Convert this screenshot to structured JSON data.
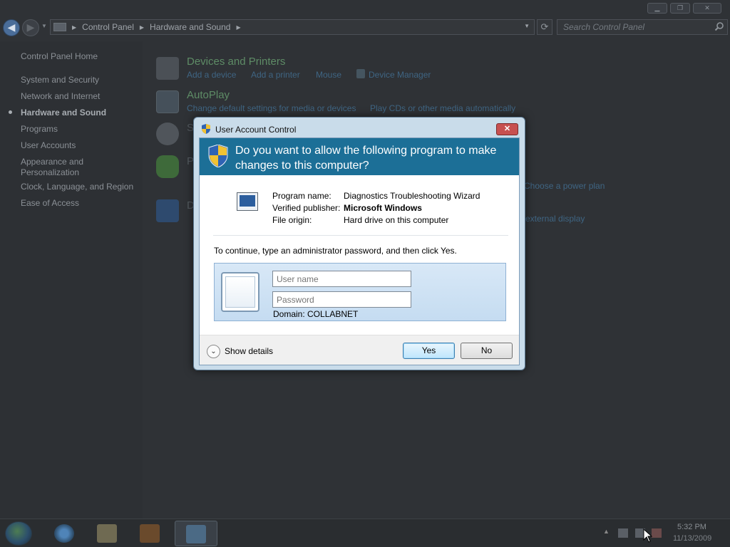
{
  "window": {
    "caption_buttons": [
      "minimize",
      "restore",
      "close"
    ]
  },
  "navbar": {
    "breadcrumb": [
      "Control Panel",
      "Hardware and Sound"
    ],
    "search_placeholder": "Search Control Panel"
  },
  "sidebar": {
    "items": [
      {
        "label": "Control Panel Home"
      },
      {
        "label": "System and Security"
      },
      {
        "label": "Network and Internet"
      },
      {
        "label": "Hardware and Sound",
        "active": true
      },
      {
        "label": "Programs"
      },
      {
        "label": "User Accounts"
      },
      {
        "label": "Appearance and Personalization"
      },
      {
        "label": "Clock, Language, and Region"
      },
      {
        "label": "Ease of Access"
      }
    ]
  },
  "main": {
    "devices_printers": {
      "title": "Devices and Printers",
      "links": [
        "Add a device",
        "Add a printer",
        "Mouse",
        "Device Manager"
      ]
    },
    "autoplay": {
      "title": "AutoPlay",
      "links": [
        "Change default settings for media or devices",
        "Play CDs or other media automatically"
      ]
    },
    "partial_links": [
      "Choose a power plan",
      "external display"
    ]
  },
  "uac": {
    "title": "User Account Control",
    "question": "Do you want to allow the following program to make changes to this computer?",
    "program_name_label": "Program name:",
    "program_name": "Diagnostics Troubleshooting Wizard",
    "publisher_label": "Verified publisher:",
    "publisher": "Microsoft Windows",
    "origin_label": "File origin:",
    "origin": "Hard drive on this computer",
    "instruction": "To continue, type an administrator password, and then click Yes.",
    "username_placeholder": "User name",
    "password_placeholder": "Password",
    "domain": "Domain: COLLABNET",
    "show_details": "Show details",
    "yes_label": "Yes",
    "no_label": "No"
  },
  "taskbar": {
    "time": "5:32 PM",
    "date": "11/13/2009"
  },
  "colors": {
    "uac_banner": "#1c6f97",
    "link": "#3f6583",
    "category_title": "#5e8c66"
  }
}
